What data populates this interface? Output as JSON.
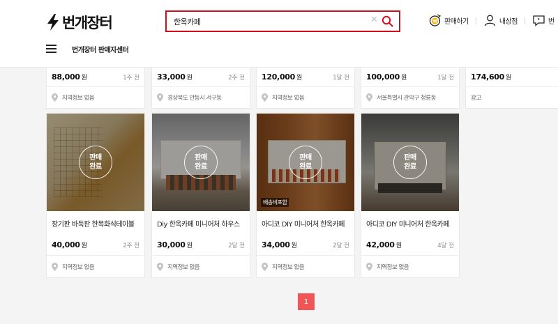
{
  "header": {
    "logo_text": "번개장터",
    "search": {
      "value": "한옥카페",
      "placeholder": ""
    },
    "links": [
      {
        "label": "판매하기",
        "icon": "sell-coin-icon"
      },
      {
        "label": "내상점",
        "icon": "user-icon"
      },
      {
        "label": "번",
        "icon": "chat-icon"
      }
    ],
    "seller_center": "번개장터 판매자센터"
  },
  "top_row": [
    {
      "price": "88,000",
      "unit": "원",
      "time": "1주 전",
      "location": "지역정보 없음"
    },
    {
      "price": "33,000",
      "unit": "원",
      "time": "2주 전",
      "location": "경상북도 안동시 서구동"
    },
    {
      "price": "120,000",
      "unit": "원",
      "time": "1달 전",
      "location": "지역정보 없음"
    },
    {
      "price": "100,000",
      "unit": "원",
      "time": "1달 전",
      "location": "서울특별시 관악구 청룡동"
    },
    {
      "price": "174,600",
      "unit": "원",
      "time": "",
      "location": "광고"
    }
  ],
  "products": [
    {
      "title": "장기판 바둑판 한목화식테이블",
      "price": "40,000",
      "unit": "원",
      "time": "2주 전",
      "location": "지역정보 없음",
      "sold": "판매\n완료",
      "badge": ""
    },
    {
      "title": "Diy 한옥카페 미니어처 하우스",
      "price": "30,000",
      "unit": "원",
      "time": "2달 전",
      "location": "지역정보 없음",
      "sold": "판매\n완료",
      "badge": ""
    },
    {
      "title": "아디코 DIY 미니어처 한옥카페",
      "price": "34,000",
      "unit": "원",
      "time": "2달 전",
      "location": "지역정보 없음",
      "sold": "판매\n완료",
      "badge": "배송비포함"
    },
    {
      "title": "아디코 DIY 미니어처 한옥카페",
      "price": "42,000",
      "unit": "원",
      "time": "4달 전",
      "location": "지역정보 없음",
      "sold": "판매\n완료",
      "badge": ""
    }
  ],
  "sold_label_line1": "판매",
  "sold_label_line2": "완료",
  "pagination": {
    "current": "1"
  },
  "colors": {
    "accent": "#d80c18",
    "pager": "#f25555"
  }
}
